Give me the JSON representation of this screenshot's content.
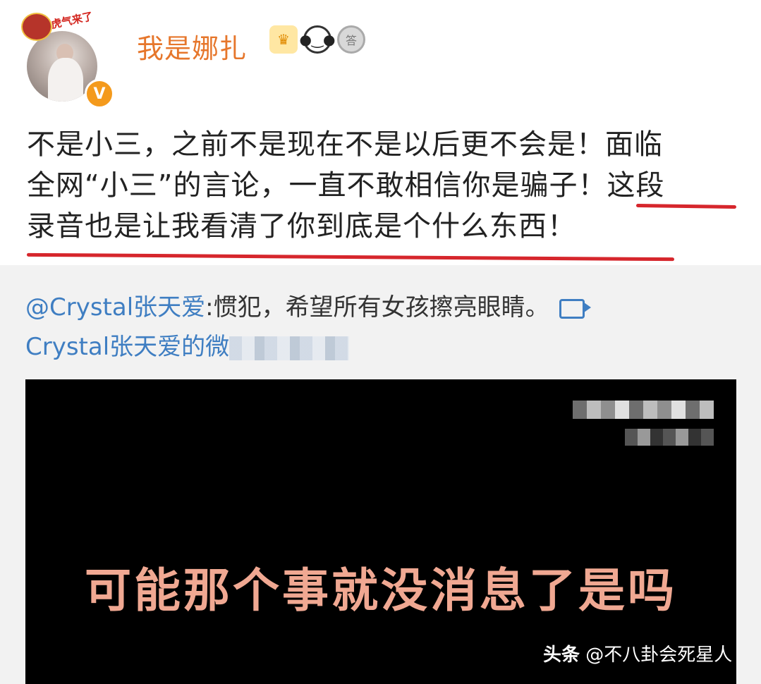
{
  "author": {
    "name": "我是娜扎",
    "pendant_text": "虎气来了",
    "verified_mark": "V",
    "badges": [
      "crown-icon",
      "panda-icon",
      "medal-icon"
    ],
    "medal_text": "答"
  },
  "post": {
    "line1": "不是小三，之前不是现在不是以后更不会是！面临",
    "line2": "全网“小三”的言论，一直不敢相信你是骗子！这段",
    "line3": "录音也是让我看清了你到底是个什么东西！",
    "underline_color": "#d6262c"
  },
  "repost": {
    "mention": "@Crystal张天爱",
    "text": ":惯犯，希望所有女孩擦亮眼睛。",
    "video_link_prefix": "Crystal张天爱的微"
  },
  "video": {
    "caption": "可能那个事就没消息了是吗"
  },
  "watermark": {
    "brand": "头条",
    "account": "@不八卦会死星人"
  },
  "colors": {
    "username": "#e6762b",
    "link": "#3f7ec2",
    "caption": "#f0a892"
  }
}
